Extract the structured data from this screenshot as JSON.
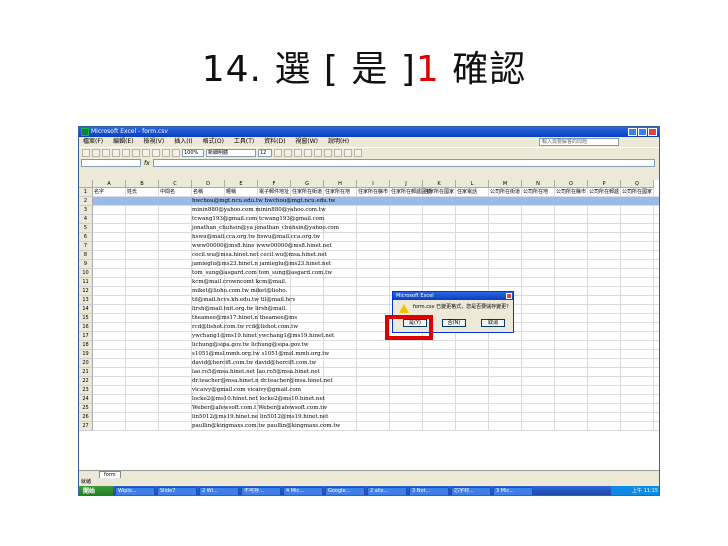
{
  "slide": {
    "number": "14.",
    "title_a": "選 [ 是 ]",
    "title_red": "1",
    "title_b": " 確認"
  },
  "window": {
    "title": "Microsoft Excel - form.csv"
  },
  "menu": [
    "檔案(F)",
    "編輯(E)",
    "檢視(V)",
    "插入(I)",
    "格式(O)",
    "工具(T)",
    "資料(D)",
    "視窗(W)",
    "說明(H)"
  ],
  "help_box": "輸入需要解答的問題",
  "toolbar": {
    "zoom": "100%",
    "font": "新細明體",
    "size": "12"
  },
  "formula": {
    "fx": "fx"
  },
  "columns": [
    "A",
    "B",
    "C",
    "D",
    "E",
    "F",
    "G",
    "H",
    "I",
    "J",
    "K",
    "L",
    "M",
    "N",
    "O",
    "P",
    "Q"
  ],
  "header_row": [
    "名字",
    "姓氏",
    "中間名",
    "名稱",
    "暱稱",
    "電子郵件地址",
    "住家所在街道",
    "住家所在地",
    "住家所在縣市",
    "住家所在郵遞區號",
    "住家所在國家",
    "住家電話",
    "公司所在街道",
    "公司所在地",
    "公司所在縣市",
    "公司所在郵遞",
    "公司所在國家"
  ],
  "rows": [
    "hwchou@mgt.ncu.edu.tw hwchou@mgt.ncu.edu.tw",
    "minin880@yahoo.com minin880@yahoo.com.tw",
    "tcwang193@gmail.com tcwang193@gmail.com",
    "jonathan_chuhsin@ya jonathan_chuhsin@yahoo.com",
    "hswu@mail.cca.org.tw hswu@mail.cca.org.tw",
    "www00000@ms8.hine www00000@ms8.hinet.net",
    "cecil.wu@msa.hinet.net cecil.wu@msa.hinet.net",
    "jamieglu@ms23.hinet.n jamieglu@ms23.hinet.net",
    "tom_sung@asgard.com tom_sung@asgard.com.tw",
    "kcm@mail.crowncomt kcm@mail.",
    "miket@lioho.com.tw miket@lioho.",
    "til@mail.hcvs.kh.edu.tw til@mail.hcv",
    "lirsh@mail.tnit.org.tw lirsh@mail.",
    "theamee@ms17.hinet.n theamee@ms",
    "rcd@lishot.com.tw rcd@lishot.com.tw",
    "ywchang1@ms19.hinet ywchang1@ms19.hinet.net",
    "lichung@sipa.gov.tw lichung@sipa.gov.tw",
    "s1051@msl.mmh.org.tw s1051@msl.mmh.org.tw",
    "david@hercift.com.tw david@hercift.com.tw",
    "lao.ro5@msa.hinet.net lao.ro5@msa.hinet.net",
    "dr.teacher@msa.hinet.n dr.teacher@msa.hinet.net",
    "vicaivy@gmail.com vicaivy@gmail.com",
    "locke2@ms10.hinet.net locke2@ms10.hinet.net",
    "Weber@afewsoft.com.t Weber@afewsoft.com.tw",
    "lin5012@ms19.hinet.ne lin5012@ms19.hinet.net",
    "paullin@kingmaxs.com.tw paullin@kingmaxs.com.tw"
  ],
  "sheet_tab": "form",
  "status": "就緒",
  "taskbar": {
    "start": "開始",
    "tasks": [
      "Wiplo...",
      "Slide7",
      "2 Wi...",
      "不可存...",
      "4 Mic...",
      "Google...",
      "2 aliz...",
      "3 Not...",
      "芯宇材...",
      "3 Mic..."
    ],
    "clock": "上午 11:15"
  },
  "dialog": {
    "title": "Microsoft Excel",
    "message": "form.csv 已變更格式，您是否要儲存變更？",
    "yes": "是(Y)",
    "no": "否(N)",
    "cancel": "取消"
  }
}
